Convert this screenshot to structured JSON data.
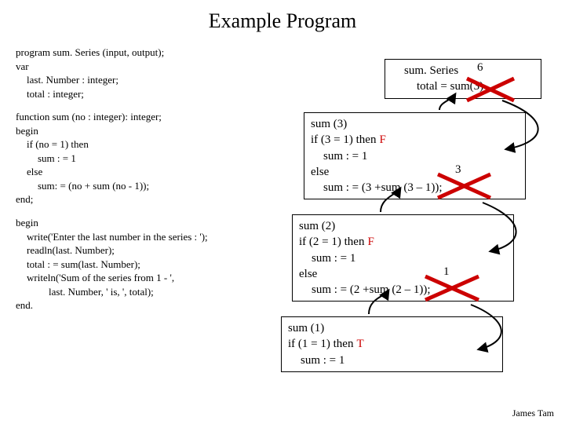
{
  "title": "Example Program",
  "footer": "James Tam",
  "code": {
    "l1": "program sum. Series (input, output);",
    "l2": "var",
    "l3": "last. Number : integer;",
    "l4": "total    : integer;",
    "l5": "function sum (no : integer): integer;",
    "l6": "begin",
    "l7": "if (no = 1) then",
    "l8": "sum : = 1",
    "l9": "else",
    "l10": "sum: = (no + sum (no - 1));",
    "l11": "end;",
    "l12": "begin",
    "l13": "write('Enter the last number in the series : ');",
    "l14": "readln(last. Number);",
    "l15": "total : = sum(last. Number);",
    "l16": "writeln('Sum of the series from 1 - ',",
    "l17": "last. Number, ' is, ', total);",
    "l18": "end."
  },
  "boxA": {
    "l1": "sum. Series",
    "l2": "total = sum(3)"
  },
  "retA": "6",
  "box3": {
    "l1": "sum (3)",
    "l2a": "if (3 = 1) then",
    "l2b": "F",
    "l3": "sum : = 1",
    "l4": "else",
    "l5": "sum : = (3 +sum (3 – 1));"
  },
  "ret3": "3",
  "box2": {
    "l1": "sum (2)",
    "l2a": "if (2 = 1) then",
    "l2b": "F",
    "l3": "sum : = 1",
    "l4": "else",
    "l5": "sum : = (2 +sum (2 – 1));"
  },
  "ret2": "1",
  "box1": {
    "l1": "sum (1)",
    "l2a": "if (1 = 1) then",
    "l2b": "T",
    "l3": "sum : = 1"
  }
}
